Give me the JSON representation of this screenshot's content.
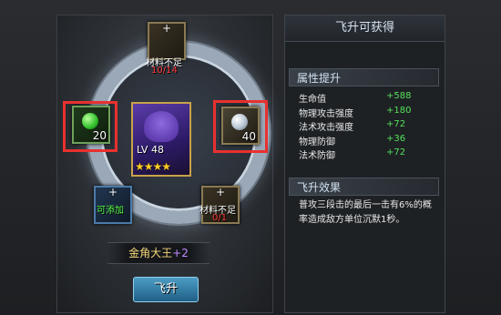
{
  "top_slot": {
    "plus": "+",
    "label": "材料不足",
    "count": "10/14"
  },
  "left_slot": {
    "count": "20"
  },
  "right_slot": {
    "count": "40"
  },
  "bottom_left_slot": {
    "plus": "+",
    "label": "可添加"
  },
  "bottom_right_slot": {
    "plus": "+",
    "label": "材料不足",
    "count": "0/1"
  },
  "hero": {
    "level": "LV 48",
    "stars": "★★★★",
    "name": "金角大王",
    "plus": "+2"
  },
  "action_button": "飞升",
  "panel": {
    "title": "飞升可获得",
    "attr_section": "属性提升",
    "stats": [
      {
        "label": "生命值",
        "value": "+588"
      },
      {
        "label": "物理攻击强度",
        "value": "+180"
      },
      {
        "label": "法术攻击强度",
        "value": "+72"
      },
      {
        "label": "物理防御",
        "value": "+36"
      },
      {
        "label": "法术防御",
        "value": "+72"
      }
    ],
    "effect_section": "飞升效果",
    "effect_text": "普攻三段击的最后一击有6%的概率造成敌方单位沉默1秒。"
  },
  "colors": {
    "highlight": "#e8312f",
    "stat_value": "#52e05a",
    "warning": "#ff3b3b"
  }
}
